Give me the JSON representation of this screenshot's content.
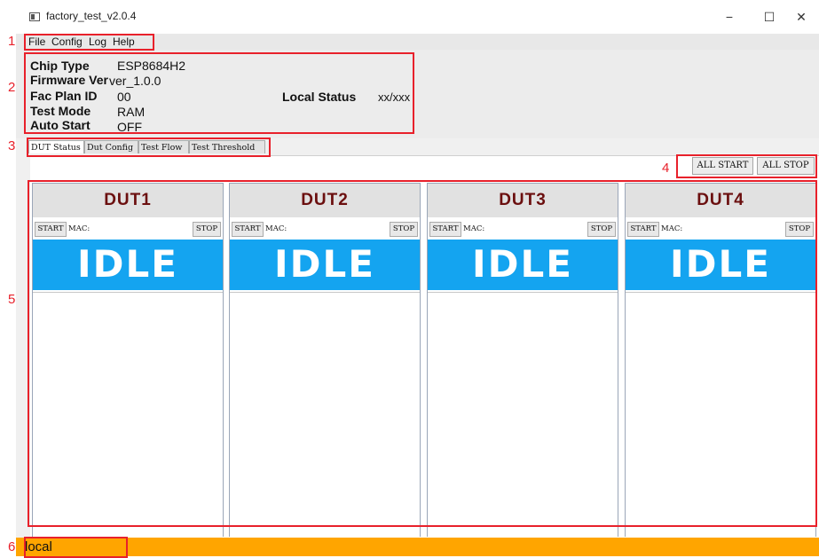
{
  "window": {
    "title": "factory_test_v2.0.4",
    "minimize": "−",
    "maximize": "☐",
    "close": "✕"
  },
  "menu": {
    "items": [
      "File",
      "Config",
      "Log",
      "Help"
    ]
  },
  "info": {
    "chip_type_label": "Chip Type",
    "chip_type_value": "ESP8684H2",
    "firmware_label": "Firmware Ver",
    "firmware_value": "ver_1.0.0",
    "fac_plan_label": "Fac Plan ID",
    "fac_plan_value": "00",
    "test_mode_label": "Test Mode",
    "test_mode_value": "RAM",
    "auto_start_label": "Auto Start",
    "auto_start_value": "OFF",
    "local_status_label": "Local Status",
    "local_status_value": "xx/xxx"
  },
  "tabs": [
    "DUT Status",
    "Dut Config",
    "Test Flow",
    "Test Threshold"
  ],
  "controls": {
    "all_start": "ALL START",
    "all_stop": "ALL STOP"
  },
  "duts": [
    {
      "title": "DUT1",
      "start": "START",
      "mac": "MAC:",
      "stop": "STOP",
      "state": "IDLE"
    },
    {
      "title": "DUT2",
      "start": "START",
      "mac": "MAC:",
      "stop": "STOP",
      "state": "IDLE"
    },
    {
      "title": "DUT3",
      "start": "START",
      "mac": "MAC:",
      "stop": "STOP",
      "state": "IDLE"
    },
    {
      "title": "DUT4",
      "start": "START",
      "mac": "MAC:",
      "stop": "STOP",
      "state": "IDLE"
    }
  ],
  "status_bar": {
    "text": "local"
  },
  "annotations": [
    "1",
    "2",
    "3",
    "4",
    "5",
    "6"
  ],
  "colors": {
    "annotation": "#e8212b",
    "idle": "#14a4f0",
    "status_bar": "#ffa500",
    "dut_title": "#6b0f0f"
  }
}
